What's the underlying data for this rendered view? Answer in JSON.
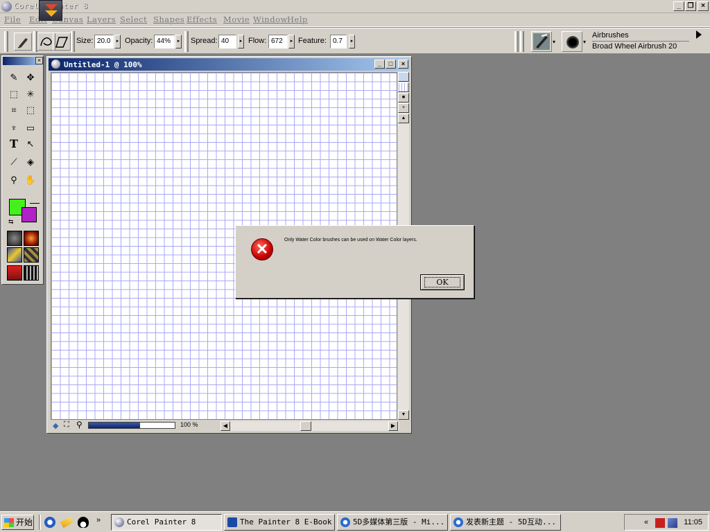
{
  "app": {
    "title": "Corel Painter 8"
  },
  "menu": [
    "File",
    "Edit",
    "Canvas",
    "Layers",
    "Select",
    "Shapes",
    "Effects",
    "Movie",
    "Window",
    "Help"
  ],
  "property_bar": {
    "size_label": "Size:",
    "size_value": "20.0",
    "opacity_label": "Opacity:",
    "opacity_value": "44%",
    "spread_label": "Spread:",
    "spread_value": "40",
    "flow_label": "Flow:",
    "flow_value": "672",
    "feature_label": "Feature:",
    "feature_value": "0.7"
  },
  "brush_selector": {
    "category": "Airbrushes",
    "variant": "Broad Wheel Airbrush 20"
  },
  "toolbox": {
    "tools": [
      "brush-icon",
      "layer-adjuster-icon",
      "rect-select-icon",
      "magic-wand-icon",
      "crop-icon",
      "lasso-icon",
      "pen-icon",
      "rectangle-shape-icon",
      "text-icon",
      "shape-selection-icon",
      "dropper-icon",
      "paint-bucket-icon",
      "magnifier-icon",
      "grabber-icon"
    ],
    "main_color": "#44f01c",
    "additional_color": "#b021c8"
  },
  "document": {
    "title": "Untitled-1 @ 100%",
    "zoom": "100 %",
    "zoom_fraction": 0.6
  },
  "dialog": {
    "message": "Only Water Color brushes can be used on Water Color layers.",
    "ok_label": "OK"
  },
  "taskbar": {
    "start_label": "开始",
    "tasks": [
      {
        "label": "Corel Painter 8",
        "active": true
      },
      {
        "label": "The Painter 8 E-Book",
        "active": false
      },
      {
        "label": "5D多媒体第三版 - Mi...",
        "active": false
      },
      {
        "label": "发表新主题 - 5D互动...",
        "active": false
      }
    ],
    "clock": "11:05"
  }
}
